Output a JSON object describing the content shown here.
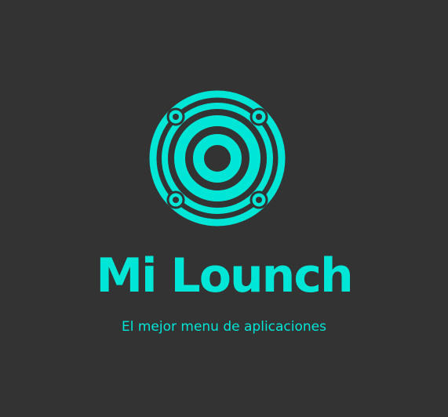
{
  "app": {
    "title": "Mi Lounch",
    "tagline": "El mejor menu de aplicaciones"
  },
  "logo": {
    "icon": "speaker-icon"
  },
  "colors": {
    "background": "#333333",
    "accent": "#00e6d6"
  }
}
